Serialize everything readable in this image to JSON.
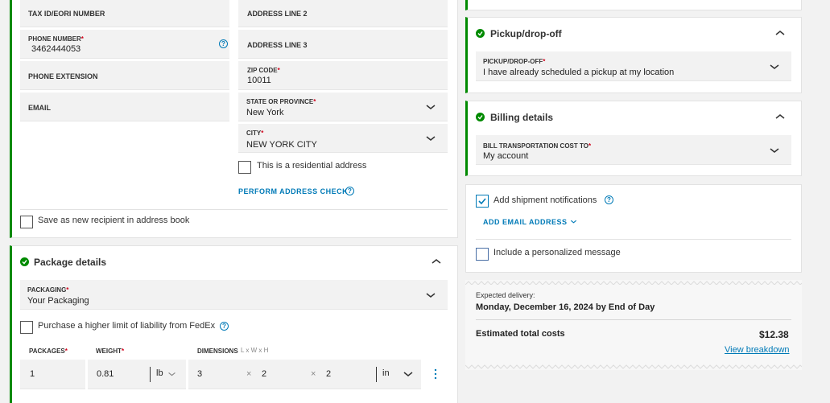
{
  "left_contact": {
    "tax_id_label": "TAX ID/EORI NUMBER",
    "phone_label": "PHONE NUMBER",
    "phone_value": "3462444053",
    "phone_ext_label": "PHONE EXTENSION",
    "email_label": "EMAIL"
  },
  "address": {
    "line2_label": "ADDRESS LINE 2",
    "line3_label": "ADDRESS LINE 3",
    "zip_label": "ZIP CODE",
    "zip_value": "10011",
    "state_label": "STATE OR PROVINCE",
    "state_value": "New York",
    "city_label": "CITY",
    "city_value": "NEW YORK CITY",
    "residential_label": "This is a residential address",
    "address_check_link": "PERFORM ADDRESS CHECK"
  },
  "save_recipient_label": "Save as new recipient in address book",
  "package": {
    "title": "Package details",
    "packaging_label": "PACKAGING",
    "packaging_value": "Your Packaging",
    "liability_label": "Purchase a higher limit of liability from FedEx",
    "packages_label": "PACKAGES",
    "weight_label": "WEIGHT",
    "dimensions_label": "DIMENSIONS",
    "dimensions_hint": "L x W x H",
    "packages_value": "1",
    "weight_value": "0.81",
    "weight_unit": "lb",
    "dim_l": "3",
    "dim_w": "2",
    "dim_h": "2",
    "dim_unit": "in",
    "times": "×"
  },
  "pickup": {
    "title": "Pickup/drop-off",
    "label": "PICKUP/DROP-OFF",
    "value": "I have already scheduled a pickup at my location"
  },
  "billing": {
    "title": "Billing details",
    "label": "BILL TRANSPORTATION COST TO",
    "value": "My account"
  },
  "notifications": {
    "label": "Add shipment notifications",
    "add_email_link": "ADD EMAIL ADDRESS",
    "personal_msg_label": "Include a personalized message",
    "checked": true
  },
  "summary": {
    "expected_label": "Expected delivery:",
    "expected_value": "Monday, December 16, 2024 by End of Day",
    "total_label": "Estimated total costs",
    "total_value": "$12.38",
    "breakdown_link": "View breakdown"
  },
  "colors": {
    "accent_green": "#008a00",
    "link_blue": "#007ab7",
    "required_red": "#d0021b"
  },
  "icons": {
    "help": "?",
    "chevron_down": "chevron-down-icon",
    "chevron_up": "chevron-up-icon",
    "check_circle": "check-circle-icon",
    "more": "vertical-dots-icon"
  }
}
